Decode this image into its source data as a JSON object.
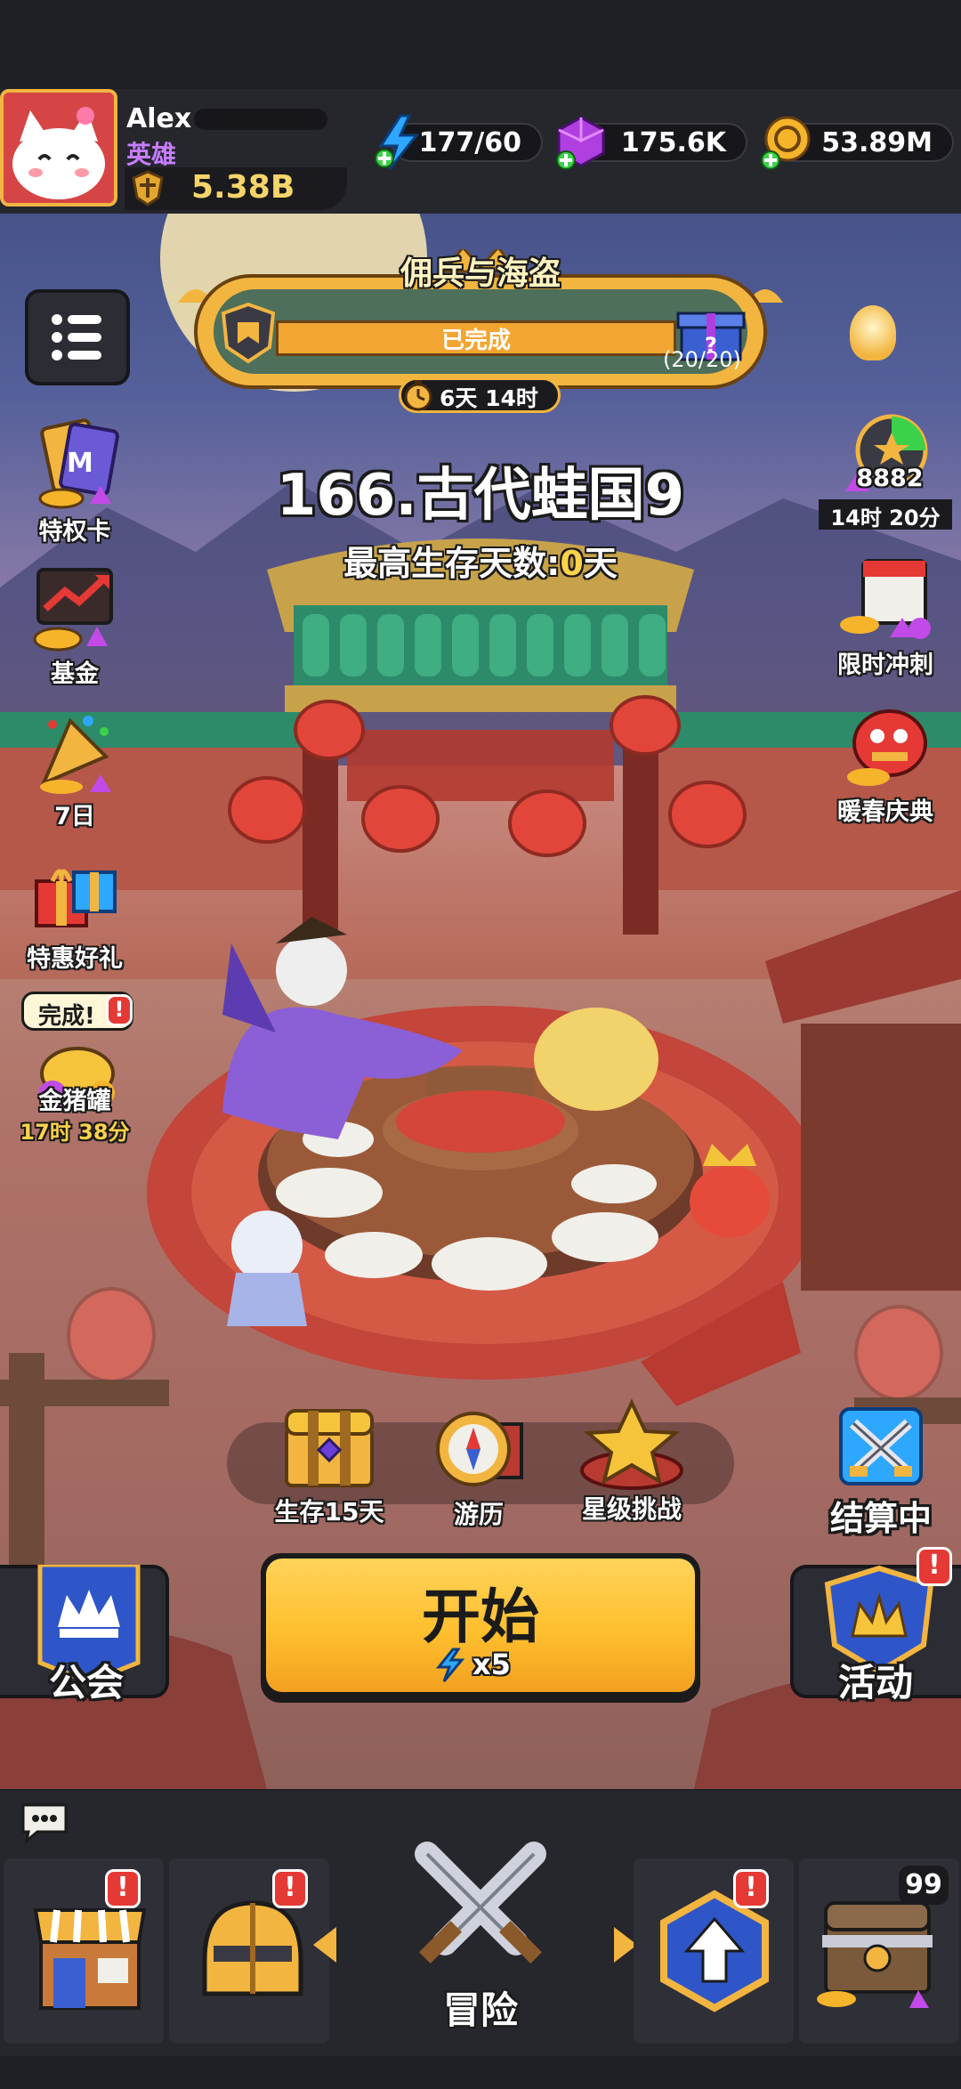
{
  "player": {
    "name": "Alex",
    "title": "英雄",
    "power": "5.38B"
  },
  "resources": {
    "energy": "177/60",
    "gems": "175.6K",
    "gold": "53.89M"
  },
  "event_banner": {
    "title": "佣兵与海盗",
    "status": "已完成",
    "progress": "(20/20)",
    "time_left": "6天 14时"
  },
  "stage": {
    "title": "166.古代蛙国9",
    "best_label": "最高生存天数:",
    "best_value": "0",
    "best_unit": "天"
  },
  "left_menu": [
    {
      "label": "特权卡"
    },
    {
      "label": "基金"
    },
    {
      "label": "7日"
    },
    {
      "label": "特惠好礼"
    },
    {
      "label": "金猪罐",
      "bubble": "完成!",
      "timer": "17时 38分"
    }
  ],
  "right_menu": [
    {
      "label": "14时 20分",
      "count": "8882"
    },
    {
      "label": "限时冲刺"
    },
    {
      "label": "暖春庆典"
    }
  ],
  "quick_actions": [
    {
      "label": "生存15天"
    },
    {
      "label": "游历"
    },
    {
      "label": "星级挑战"
    }
  ],
  "settlement": {
    "label": "结算中"
  },
  "start_button": {
    "label": "开始",
    "cost": "x5"
  },
  "guild": {
    "label": "公会"
  },
  "activity": {
    "label": "活动"
  },
  "bottom_nav": {
    "center_label": "冒险",
    "chest_count": "99"
  },
  "colors": {
    "gold": "#f6b42a",
    "panel": "#26262d",
    "alert": "#e53935",
    "energy": "#2ea7ff",
    "gem": "#b03fe0"
  }
}
